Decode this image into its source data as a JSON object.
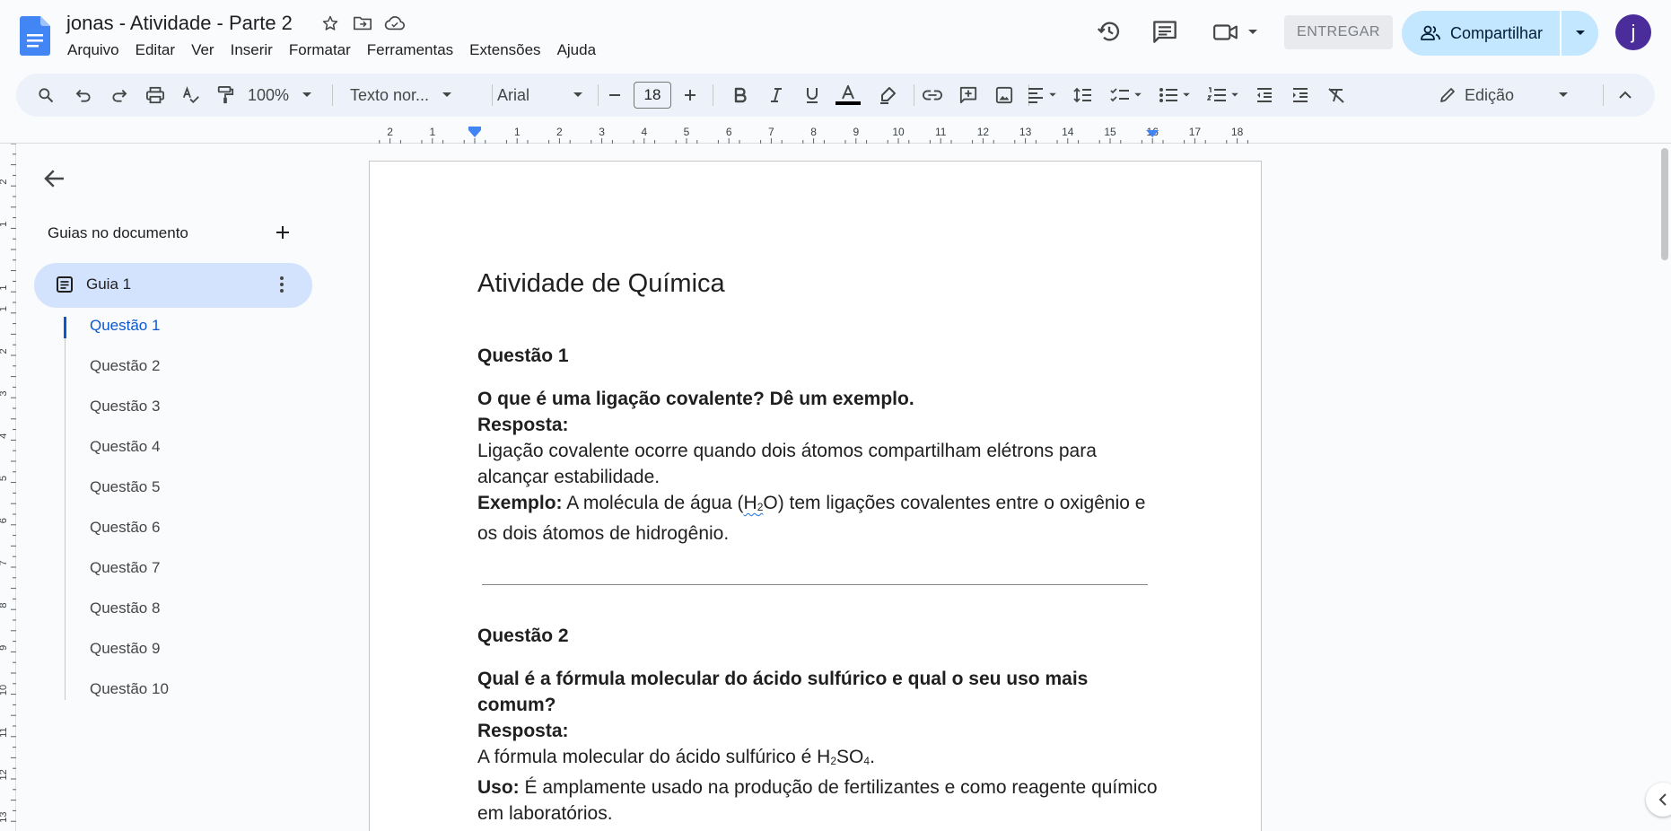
{
  "doc": {
    "title": "jonas - Atividade - Parte 2"
  },
  "menu": [
    "Arquivo",
    "Editar",
    "Ver",
    "Inserir",
    "Formatar",
    "Ferramentas",
    "Extensões",
    "Ajuda"
  ],
  "header": {
    "entregar_label": "ENTREGAR",
    "share_label": "Compartilhar",
    "avatar_initial": "j"
  },
  "toolbar": {
    "zoom": "100%",
    "style": "Texto nor...",
    "font": "Arial",
    "font_size": "18",
    "mode": "Edição"
  },
  "ruler": {
    "marks": [
      "2",
      "1",
      "1",
      "2",
      "3",
      "4",
      "5",
      "6",
      "7",
      "8",
      "9",
      "10",
      "11",
      "12",
      "13",
      "14",
      "15",
      "16",
      "17",
      "18"
    ]
  },
  "vruler": {
    "marks": [
      "2",
      "1",
      "1",
      "1",
      "2",
      "3",
      "4",
      "5",
      "6",
      "7",
      "8",
      "9",
      "10",
      "11",
      "12",
      "13"
    ]
  },
  "sidebar": {
    "heading": "Guias no documento",
    "tab_label": "Guia 1",
    "items": [
      "Questão 1",
      "Questão 2",
      "Questão 3",
      "Questão 4",
      "Questão 5",
      "Questão 6",
      "Questão 7",
      "Questão 8",
      "Questão 9",
      "Questão 10"
    ]
  },
  "page": {
    "title": "Atividade de Química",
    "q1": {
      "heading": "Questão 1",
      "question": "O que é uma ligação covalente? Dê um exemplo.",
      "answer_label": "Resposta:",
      "answer": "Ligação covalente ocorre quando dois átomos compartilham elétrons para alcançar estabilidade.",
      "example_label": "Exemplo:",
      "example_pre": " A molécula de água (",
      "example_h": "H",
      "example_sub": "2",
      "example_o": "O",
      "example_post": ") tem ligações covalentes entre o oxigênio e os dois átomos de hidrogênio."
    },
    "q2": {
      "heading": "Questão 2",
      "question": "Qual é a fórmula molecular do ácido sulfúrico e qual o seu uso mais comum?",
      "answer_label": "Resposta:",
      "answer_pre": "A fórmula molecular do ácido sulfúrico é H",
      "answer_sub1": "2",
      "answer_mid": "SO",
      "answer_sub2": "4",
      "answer_post": ".",
      "use_label": "Uso:",
      "use_text": " É amplamente usado na produção de fertilizantes e como reagente químico em laboratórios."
    }
  },
  "colors": {
    "accent": "#0b57d0",
    "share_bg": "#c2e7ff",
    "tab_bg": "#d3e3fd",
    "avatar_bg": "#4a2c9b"
  }
}
